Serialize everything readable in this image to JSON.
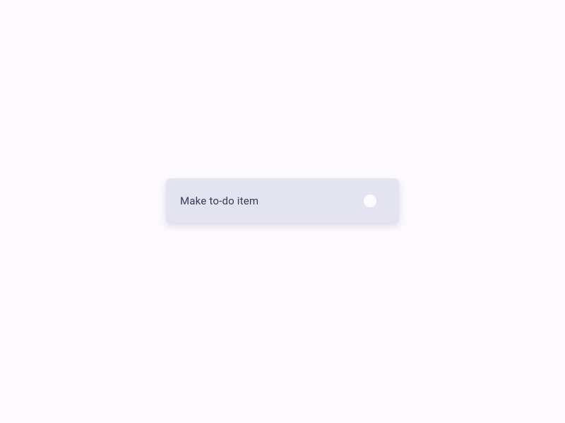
{
  "todo": {
    "label": "Make to-do item"
  }
}
